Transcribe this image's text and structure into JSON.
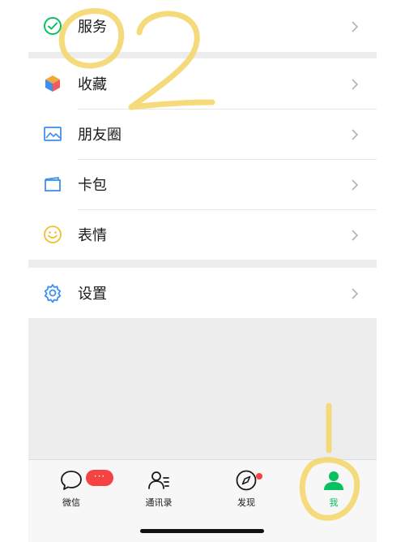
{
  "menu": {
    "services_label": "服务",
    "favorites_label": "收藏",
    "moments_label": "朋友圈",
    "cards_label": "卡包",
    "stickers_label": "表情",
    "settings_label": "设置"
  },
  "tabbar": {
    "chats_label": "微信",
    "contacts_label": "通讯录",
    "discover_label": "发现",
    "me_label": "我",
    "chats_badge": "···"
  },
  "colors": {
    "accent": "#07c160",
    "badge": "#f54343",
    "annotation": "#f5d76e"
  },
  "icons": [
    "check-circle-icon",
    "cube-icon",
    "picture-icon",
    "card-icon",
    "smile-icon",
    "gear-icon",
    "chevron-right-icon",
    "chat-bubble-icon",
    "contacts-icon",
    "compass-icon",
    "person-icon"
  ]
}
